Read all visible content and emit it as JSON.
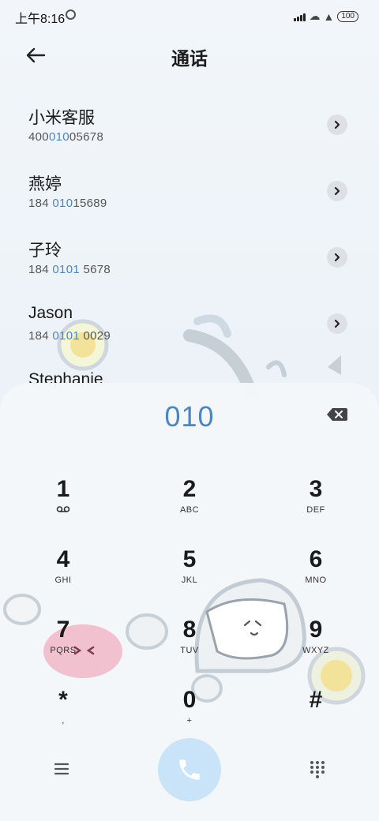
{
  "status_bar": {
    "time": "上午8:16",
    "battery": "100"
  },
  "header": {
    "title": "通话"
  },
  "contacts": [
    {
      "name": "小米客服",
      "number_pre": "400",
      "number_hl": "010",
      "number_post": "05678"
    },
    {
      "name": "燕婷",
      "number_pre": "184 ",
      "number_hl": "010",
      "number_post": "15689"
    },
    {
      "name": "子玲",
      "number_pre": "184 ",
      "number_hl": "0101",
      "number_post": " 5678"
    },
    {
      "name": "Jason",
      "number_pre": "184 ",
      "number_hl": "0101",
      "number_post": " 0029"
    },
    {
      "name": "Stephanie"
    }
  ],
  "dialer": {
    "dialed": "010",
    "keys": [
      {
        "num": "1",
        "sub": ""
      },
      {
        "num": "2",
        "sub": "ABC"
      },
      {
        "num": "3",
        "sub": "DEF"
      },
      {
        "num": "4",
        "sub": "GHI"
      },
      {
        "num": "5",
        "sub": "JKL"
      },
      {
        "num": "6",
        "sub": "MNO"
      },
      {
        "num": "7",
        "sub": "PQRS"
      },
      {
        "num": "8",
        "sub": "TUV"
      },
      {
        "num": "9",
        "sub": "WXYZ"
      },
      {
        "num": "*",
        "sub": ","
      },
      {
        "num": "0",
        "sub": "+"
      },
      {
        "num": "#",
        "sub": ""
      }
    ]
  },
  "icons": {
    "back": "arrow-left-icon",
    "chevron": "chevron-right-icon",
    "backspace": "backspace-icon",
    "voicemail": "voicemail-icon",
    "menu": "menu-icon",
    "call": "phone-icon",
    "dialpad": "dialpad-icon"
  },
  "colors": {
    "accent": "#4a86c1",
    "call_button": "#c9e3f8"
  }
}
